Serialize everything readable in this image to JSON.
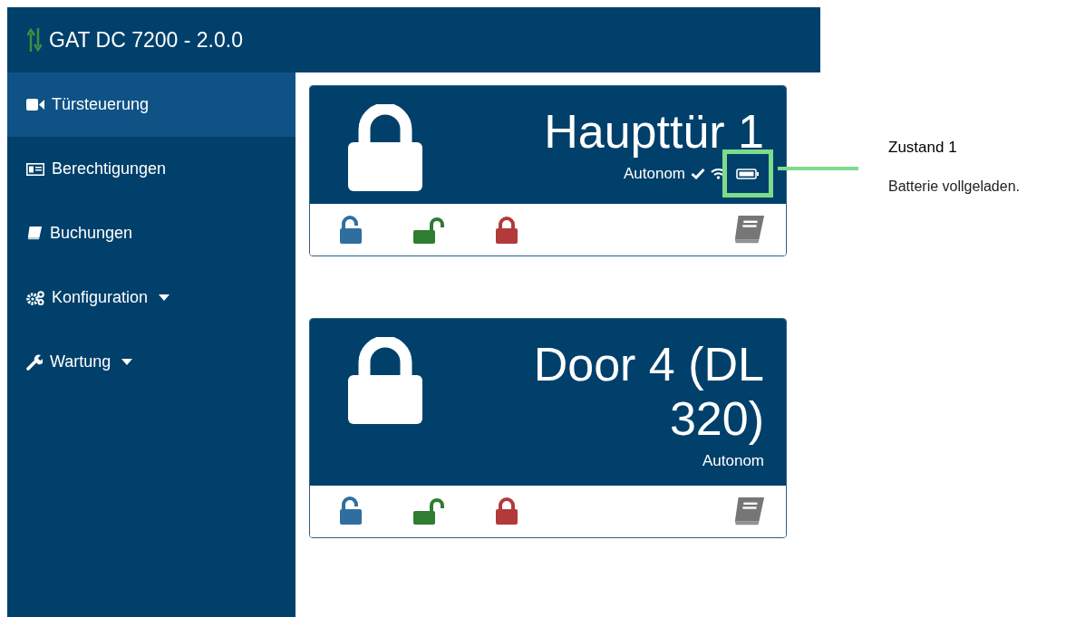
{
  "app": {
    "title": "GAT DC 7200 - 2.0.0"
  },
  "nav": [
    {
      "label": "Türsteuerung",
      "selected": true,
      "dropdown": false
    },
    {
      "label": "Berechtigungen",
      "selected": false,
      "dropdown": false
    },
    {
      "label": "Buchungen",
      "selected": false,
      "dropdown": false
    },
    {
      "label": "Konfiguration",
      "selected": false,
      "dropdown": true
    },
    {
      "label": "Wartung",
      "selected": false,
      "dropdown": true
    }
  ],
  "doors": [
    {
      "name": "Haupttür 1",
      "mode": "Autonom",
      "online": true
    },
    {
      "name": "Door 4 (DL 320)",
      "mode": "Autonom",
      "online": false
    }
  ],
  "annotation": {
    "title": "Zustand 1",
    "text": "Batterie vollgeladen."
  }
}
